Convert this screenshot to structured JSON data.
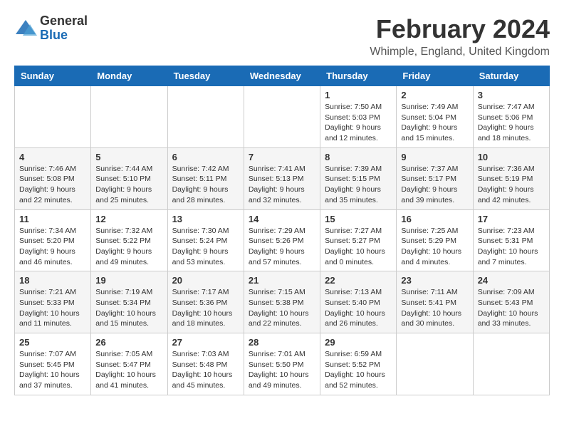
{
  "logo": {
    "general": "General",
    "blue": "Blue"
  },
  "title": "February 2024",
  "location": "Whimple, England, United Kingdom",
  "days_of_week": [
    "Sunday",
    "Monday",
    "Tuesday",
    "Wednesday",
    "Thursday",
    "Friday",
    "Saturday"
  ],
  "weeks": [
    [
      {
        "day": "",
        "sunrise": "",
        "sunset": "",
        "daylight": ""
      },
      {
        "day": "",
        "sunrise": "",
        "sunset": "",
        "daylight": ""
      },
      {
        "day": "",
        "sunrise": "",
        "sunset": "",
        "daylight": ""
      },
      {
        "day": "",
        "sunrise": "",
        "sunset": "",
        "daylight": ""
      },
      {
        "day": "1",
        "sunrise": "Sunrise: 7:50 AM",
        "sunset": "Sunset: 5:03 PM",
        "daylight": "Daylight: 9 hours and 12 minutes."
      },
      {
        "day": "2",
        "sunrise": "Sunrise: 7:49 AM",
        "sunset": "Sunset: 5:04 PM",
        "daylight": "Daylight: 9 hours and 15 minutes."
      },
      {
        "day": "3",
        "sunrise": "Sunrise: 7:47 AM",
        "sunset": "Sunset: 5:06 PM",
        "daylight": "Daylight: 9 hours and 18 minutes."
      }
    ],
    [
      {
        "day": "4",
        "sunrise": "Sunrise: 7:46 AM",
        "sunset": "Sunset: 5:08 PM",
        "daylight": "Daylight: 9 hours and 22 minutes."
      },
      {
        "day": "5",
        "sunrise": "Sunrise: 7:44 AM",
        "sunset": "Sunset: 5:10 PM",
        "daylight": "Daylight: 9 hours and 25 minutes."
      },
      {
        "day": "6",
        "sunrise": "Sunrise: 7:42 AM",
        "sunset": "Sunset: 5:11 PM",
        "daylight": "Daylight: 9 hours and 28 minutes."
      },
      {
        "day": "7",
        "sunrise": "Sunrise: 7:41 AM",
        "sunset": "Sunset: 5:13 PM",
        "daylight": "Daylight: 9 hours and 32 minutes."
      },
      {
        "day": "8",
        "sunrise": "Sunrise: 7:39 AM",
        "sunset": "Sunset: 5:15 PM",
        "daylight": "Daylight: 9 hours and 35 minutes."
      },
      {
        "day": "9",
        "sunrise": "Sunrise: 7:37 AM",
        "sunset": "Sunset: 5:17 PM",
        "daylight": "Daylight: 9 hours and 39 minutes."
      },
      {
        "day": "10",
        "sunrise": "Sunrise: 7:36 AM",
        "sunset": "Sunset: 5:19 PM",
        "daylight": "Daylight: 9 hours and 42 minutes."
      }
    ],
    [
      {
        "day": "11",
        "sunrise": "Sunrise: 7:34 AM",
        "sunset": "Sunset: 5:20 PM",
        "daylight": "Daylight: 9 hours and 46 minutes."
      },
      {
        "day": "12",
        "sunrise": "Sunrise: 7:32 AM",
        "sunset": "Sunset: 5:22 PM",
        "daylight": "Daylight: 9 hours and 49 minutes."
      },
      {
        "day": "13",
        "sunrise": "Sunrise: 7:30 AM",
        "sunset": "Sunset: 5:24 PM",
        "daylight": "Daylight: 9 hours and 53 minutes."
      },
      {
        "day": "14",
        "sunrise": "Sunrise: 7:29 AM",
        "sunset": "Sunset: 5:26 PM",
        "daylight": "Daylight: 9 hours and 57 minutes."
      },
      {
        "day": "15",
        "sunrise": "Sunrise: 7:27 AM",
        "sunset": "Sunset: 5:27 PM",
        "daylight": "Daylight: 10 hours and 0 minutes."
      },
      {
        "day": "16",
        "sunrise": "Sunrise: 7:25 AM",
        "sunset": "Sunset: 5:29 PM",
        "daylight": "Daylight: 10 hours and 4 minutes."
      },
      {
        "day": "17",
        "sunrise": "Sunrise: 7:23 AM",
        "sunset": "Sunset: 5:31 PM",
        "daylight": "Daylight: 10 hours and 7 minutes."
      }
    ],
    [
      {
        "day": "18",
        "sunrise": "Sunrise: 7:21 AM",
        "sunset": "Sunset: 5:33 PM",
        "daylight": "Daylight: 10 hours and 11 minutes."
      },
      {
        "day": "19",
        "sunrise": "Sunrise: 7:19 AM",
        "sunset": "Sunset: 5:34 PM",
        "daylight": "Daylight: 10 hours and 15 minutes."
      },
      {
        "day": "20",
        "sunrise": "Sunrise: 7:17 AM",
        "sunset": "Sunset: 5:36 PM",
        "daylight": "Daylight: 10 hours and 18 minutes."
      },
      {
        "day": "21",
        "sunrise": "Sunrise: 7:15 AM",
        "sunset": "Sunset: 5:38 PM",
        "daylight": "Daylight: 10 hours and 22 minutes."
      },
      {
        "day": "22",
        "sunrise": "Sunrise: 7:13 AM",
        "sunset": "Sunset: 5:40 PM",
        "daylight": "Daylight: 10 hours and 26 minutes."
      },
      {
        "day": "23",
        "sunrise": "Sunrise: 7:11 AM",
        "sunset": "Sunset: 5:41 PM",
        "daylight": "Daylight: 10 hours and 30 minutes."
      },
      {
        "day": "24",
        "sunrise": "Sunrise: 7:09 AM",
        "sunset": "Sunset: 5:43 PM",
        "daylight": "Daylight: 10 hours and 33 minutes."
      }
    ],
    [
      {
        "day": "25",
        "sunrise": "Sunrise: 7:07 AM",
        "sunset": "Sunset: 5:45 PM",
        "daylight": "Daylight: 10 hours and 37 minutes."
      },
      {
        "day": "26",
        "sunrise": "Sunrise: 7:05 AM",
        "sunset": "Sunset: 5:47 PM",
        "daylight": "Daylight: 10 hours and 41 minutes."
      },
      {
        "day": "27",
        "sunrise": "Sunrise: 7:03 AM",
        "sunset": "Sunset: 5:48 PM",
        "daylight": "Daylight: 10 hours and 45 minutes."
      },
      {
        "day": "28",
        "sunrise": "Sunrise: 7:01 AM",
        "sunset": "Sunset: 5:50 PM",
        "daylight": "Daylight: 10 hours and 49 minutes."
      },
      {
        "day": "29",
        "sunrise": "Sunrise: 6:59 AM",
        "sunset": "Sunset: 5:52 PM",
        "daylight": "Daylight: 10 hours and 52 minutes."
      },
      {
        "day": "",
        "sunrise": "",
        "sunset": "",
        "daylight": ""
      },
      {
        "day": "",
        "sunrise": "",
        "sunset": "",
        "daylight": ""
      }
    ]
  ]
}
